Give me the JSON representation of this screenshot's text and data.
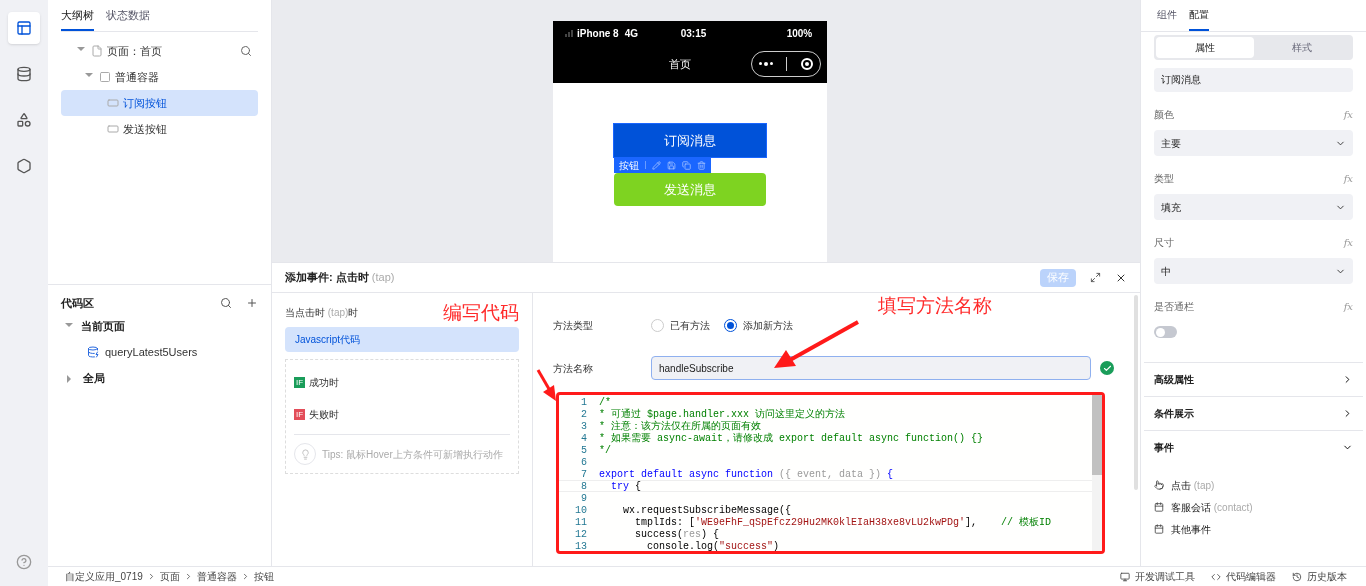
{
  "rail": {
    "items": [
      {
        "selected": true
      },
      {
        "selected": false
      },
      {
        "selected": false
      },
      {
        "selected": false
      }
    ]
  },
  "outline": {
    "tabs": [
      {
        "label": "大纲树",
        "selected": true
      },
      {
        "label": "状态数据",
        "selected": false
      }
    ],
    "tree": [
      {
        "label": "页面：首页",
        "kind": "page",
        "expanded": true,
        "selected": false,
        "children": [
          {
            "label": "普通容器",
            "kind": "container",
            "expanded": true,
            "selected": false,
            "children": [
              {
                "label": "订阅按钮",
                "kind": "button",
                "selected": true
              },
              {
                "label": "发送按钮",
                "kind": "button",
                "selected": false
              }
            ]
          }
        ]
      }
    ]
  },
  "code_area": {
    "title": "代码区",
    "groups": [
      {
        "label": "当前页面",
        "expanded": true,
        "children": [
          {
            "label": "queryLatest5Users"
          }
        ]
      },
      {
        "label": "全局",
        "expanded": false
      }
    ]
  },
  "phone": {
    "carrier": "iPhone 8",
    "network": "4G",
    "time": "03:15",
    "battery": "100%",
    "page_title": "首页",
    "buttons": [
      {
        "label": "订阅消息",
        "color": "#0052d9",
        "selected": true
      },
      {
        "label": "发送消息",
        "color": "#7ed321",
        "selected": false
      }
    ],
    "toolbar_label": "按钮"
  },
  "event_panel": {
    "title": "添加事件: 点击时",
    "title_hint": "(tap)",
    "save": {
      "label": "保存",
      "disabled": true
    },
    "trigger": {
      "prefix": "当点击时",
      "hint": "(tap)",
      "suffix": "时"
    },
    "action": {
      "label": "Javascript代码",
      "selected": true
    },
    "branches": [
      {
        "badge": "IF",
        "label": "成功时",
        "color": "#1a9d5a"
      },
      {
        "badge": "IF",
        "label": "失败时",
        "color": "#e34d59"
      }
    ],
    "tips": "Tips: 鼠标Hover上方条件可新增执行动作",
    "method_type": {
      "label": "方法类型",
      "options": [
        {
          "label": "已有方法",
          "selected": false
        },
        {
          "label": "添加新方法",
          "selected": true
        }
      ]
    },
    "method_name": {
      "label": "方法名称",
      "value": "handleSubscribe",
      "valid": true
    },
    "code": [
      {
        "number": "1",
        "current": false,
        "segments": [
          {
            "kind": "comment",
            "text": "/*"
          }
        ]
      },
      {
        "number": "2",
        "current": false,
        "segments": [
          {
            "kind": "comment",
            "text": "* 可通过 $page.handler.xxx 访问这里定义的方法"
          }
        ]
      },
      {
        "number": "3",
        "current": false,
        "segments": [
          {
            "kind": "comment",
            "text": "* 注意：该方法仅在所属的页面有效"
          }
        ]
      },
      {
        "number": "4",
        "current": false,
        "segments": [
          {
            "kind": "comment",
            "text": "* 如果需要 async-await，请修改成 export default async function() {}"
          }
        ]
      },
      {
        "number": "5",
        "current": false,
        "segments": [
          {
            "kind": "comment",
            "text": "*/"
          }
        ]
      },
      {
        "number": "6",
        "current": false
      },
      {
        "number": "7",
        "current": false,
        "segments": [
          {
            "kind": "keyword",
            "text": "export default async function "
          },
          {
            "kind": "param",
            "text": "({ event, data })"
          },
          {
            "kind": "keyword",
            "text": " {"
          }
        ]
      },
      {
        "number": "8",
        "current": true,
        "segments": [
          {
            "kind": "keyword",
            "text": "  try"
          },
          {
            "kind": "plain",
            "text": " {"
          }
        ]
      },
      {
        "number": "9",
        "current": false
      },
      {
        "number": "10",
        "current": false,
        "segments": [
          {
            "kind": "plain",
            "text": "    wx.requestSubscribeMessage({"
          }
        ]
      },
      {
        "number": "11",
        "current": false,
        "segments": [
          {
            "kind": "plain",
            "text": "      tmplIds: ["
          },
          {
            "kind": "string",
            "text": "'WE9eFhF_qSpEfcz29Hu2MK0klEIaH38xe8vLU2kwPDg'"
          },
          {
            "kind": "plain",
            "text": "],    "
          },
          {
            "kind": "comment",
            "text": "// 模板ID"
          }
        ]
      },
      {
        "number": "12",
        "current": false,
        "segments": [
          {
            "kind": "plain",
            "text": "      success("
          },
          {
            "kind": "param",
            "text": "res"
          },
          {
            "kind": "plain",
            "text": ") {"
          }
        ]
      },
      {
        "number": "13",
        "current": false,
        "segments": [
          {
            "kind": "plain",
            "text": "        console.log("
          },
          {
            "kind": "string",
            "text": "\"success\""
          },
          {
            "kind": "plain",
            "text": ")"
          }
        ]
      }
    ]
  },
  "annotations": [
    {
      "text": "编写代码"
    },
    {
      "text": "填写方法名称"
    }
  ],
  "settings": {
    "tabs": [
      {
        "label": "组件",
        "selected": false
      },
      {
        "label": "配置",
        "selected": true
      }
    ],
    "segments": [
      {
        "label": "属性",
        "selected": true
      },
      {
        "label": "样式",
        "selected": false
      }
    ],
    "text_value": "订阅消息",
    "fields": [
      {
        "label": "颜色",
        "fx": "fx",
        "kind": "select",
        "value": "主要"
      },
      {
        "label": "类型",
        "fx": "fx",
        "kind": "select",
        "value": "填充"
      },
      {
        "label": "尺寸",
        "fx": "fx",
        "kind": "select",
        "value": "中"
      },
      {
        "label": "是否通栏",
        "fx": "fx",
        "kind": "toggle",
        "on": false
      }
    ],
    "sections": [
      {
        "label": "高级属性",
        "expanded": false
      },
      {
        "label": "条件展示",
        "expanded": false
      },
      {
        "label": "事件",
        "expanded": true
      }
    ],
    "events": [
      {
        "label": "点击",
        "hint": "(tap)",
        "kind": "tap"
      },
      {
        "label": "客服会话",
        "hint": "(contact)",
        "kind": "event"
      },
      {
        "label": "其他事件",
        "kind": "event"
      }
    ]
  },
  "breadcrumb": [
    "自定义应用_0719",
    "页面",
    "普通容器",
    "按钮"
  ],
  "tools": [
    {
      "label": "开发调试工具",
      "kind": "debug"
    },
    {
      "label": "代码编辑器",
      "kind": "code"
    },
    {
      "label": "历史版本",
      "kind": "history"
    }
  ]
}
